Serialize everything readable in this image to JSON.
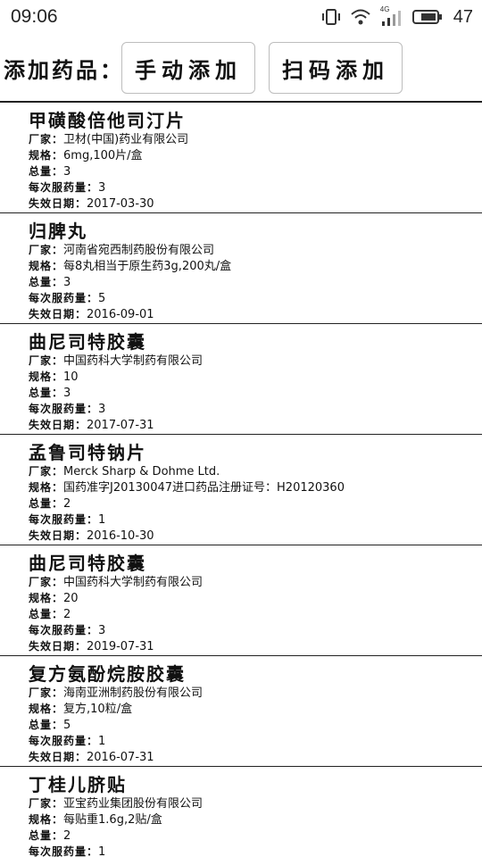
{
  "status_bar": {
    "time": "09:06",
    "network_label": "4G",
    "battery": "47"
  },
  "toolbar": {
    "label": "添加药品：",
    "manual_add_label": "手动添加",
    "scan_add_label": "扫码添加"
  },
  "field_labels": {
    "manufacturer": "厂家：",
    "spec": "规格：",
    "total": "总量：",
    "dose": "每次服药量：",
    "expiry": "失效日期："
  },
  "drugs": [
    {
      "name": "甲磺酸倍他司汀片",
      "manufacturer": "卫材(中国)药业有限公司",
      "spec": "6mg,100片/盒",
      "total": "3",
      "dose": "3",
      "expiry": "2017-03-30"
    },
    {
      "name": "归脾丸",
      "manufacturer": "河南省宛西制药股份有限公司",
      "spec": "每8丸相当于原生药3g,200丸/盒",
      "total": "3",
      "dose": "5",
      "expiry": "2016-09-01"
    },
    {
      "name": "曲尼司特胶囊",
      "manufacturer": "中国药科大学制药有限公司",
      "spec": "10",
      "total": "3",
      "dose": "3",
      "expiry": "2017-07-31"
    },
    {
      "name": "孟鲁司特钠片",
      "manufacturer": "Merck Sharp & Dohme Ltd.",
      "spec": "国药准字J20130047进口药品注册证号：H20120360",
      "total": "2",
      "dose": "1",
      "expiry": "2016-10-30"
    },
    {
      "name": "曲尼司特胶囊",
      "manufacturer": "中国药科大学制药有限公司",
      "spec": "20",
      "total": "2",
      "dose": "3",
      "expiry": "2019-07-31"
    },
    {
      "name": "复方氨酚烷胺胶囊",
      "manufacturer": "海南亚洲制药股份有限公司",
      "spec": "复方,10粒/盒",
      "total": "5",
      "dose": "1",
      "expiry": "2016-07-31"
    },
    {
      "name": "丁桂儿脐贴",
      "manufacturer": "亚宝药业集团股份有限公司",
      "spec": "每贴重1.6g,2贴/盒",
      "total": "2",
      "dose": "1",
      "expiry": ""
    }
  ]
}
